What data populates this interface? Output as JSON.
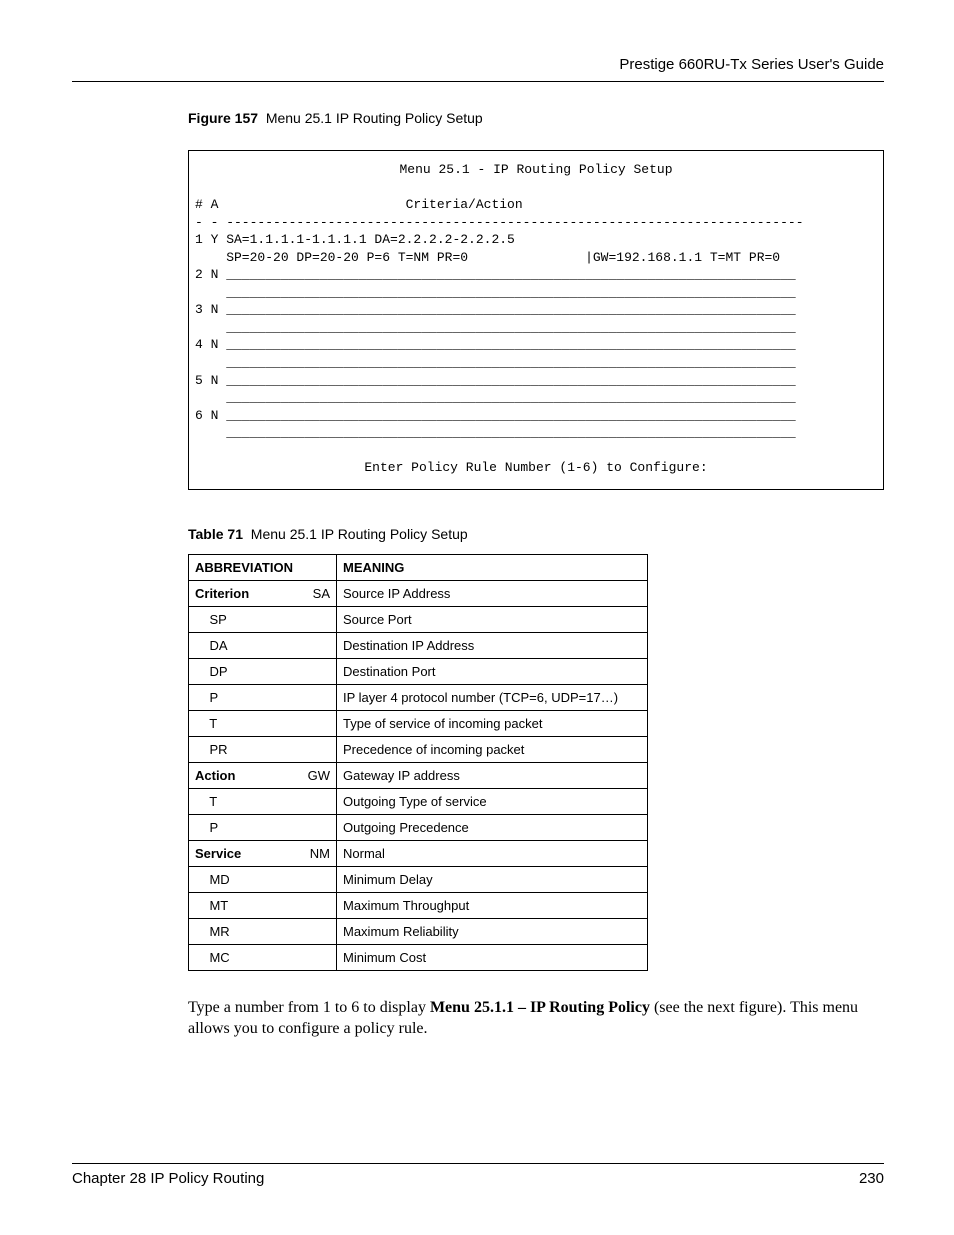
{
  "header": {
    "guide_title": "Prestige 660RU-Tx Series User's Guide"
  },
  "figure": {
    "label": "Figure 157",
    "title": "Menu 25.1 IP Routing Policy Setup",
    "menu_title": "Menu 25.1 - IP Routing Policy Setup",
    "cols_header": "# A                        Criteria/Action",
    "divider": "- - --------------------------------------------------------------------------",
    "row1a": "1 Y SA=1.1.1.1-1.1.1.1 DA=2.2.2.2-2.2.2.5",
    "row1b": "    SP=20-20 DP=20-20 P=6 T=NM PR=0               |GW=192.168.1.1 T=MT PR=0",
    "row2": "2 N _________________________________________________________________________",
    "rowpad": "    _________________________________________________________________________",
    "row3": "3 N _________________________________________________________________________",
    "row4": "4 N _________________________________________________________________________",
    "row5": "5 N _________________________________________________________________________",
    "row6": "6 N _________________________________________________________________________",
    "prompt": "Enter Policy Rule Number (1-6) to Configure:"
  },
  "table": {
    "label": "Table 71",
    "title": "Menu 25.1 IP Routing Policy Setup",
    "headers": {
      "abbr": "ABBREVIATION",
      "meaning": "MEANING"
    },
    "rows": [
      {
        "left": "Criterion",
        "right": "SA",
        "left_bold": true,
        "meaning": "Source IP Address"
      },
      {
        "left": "    SP",
        "right": "",
        "left_bold": false,
        "meaning": "Source Port"
      },
      {
        "left": "    DA",
        "right": "",
        "left_bold": false,
        "meaning": "Destination IP Address"
      },
      {
        "left": "    DP",
        "right": "",
        "left_bold": false,
        "meaning": "Destination Port"
      },
      {
        "left": "    P",
        "right": "",
        "left_bold": false,
        "meaning": "IP layer 4 protocol number (TCP=6, UDP=17…)"
      },
      {
        "left": "    T",
        "right": "",
        "left_bold": false,
        "meaning": "Type of service of incoming packet"
      },
      {
        "left": "    PR",
        "right": "",
        "left_bold": false,
        "meaning": "Precedence of incoming packet"
      },
      {
        "left": "Action",
        "right": "GW",
        "left_bold": true,
        "meaning": "Gateway IP address"
      },
      {
        "left": "    T",
        "right": "",
        "left_bold": false,
        "meaning": "Outgoing Type of service"
      },
      {
        "left": "    P",
        "right": "",
        "left_bold": false,
        "meaning": "Outgoing Precedence"
      },
      {
        "left": "Service",
        "right": "NM",
        "left_bold": true,
        "meaning": "Normal"
      },
      {
        "left": "    MD",
        "right": "",
        "left_bold": false,
        "meaning": "Minimum Delay"
      },
      {
        "left": "    MT",
        "right": "",
        "left_bold": false,
        "meaning": "Maximum Throughput"
      },
      {
        "left": "    MR",
        "right": "",
        "left_bold": false,
        "meaning": "Maximum Reliability"
      },
      {
        "left": "    MC",
        "right": "",
        "left_bold": false,
        "meaning": "Minimum Cost"
      }
    ]
  },
  "paragraph": {
    "pre": "Type a number from 1 to 6 to display ",
    "bold": "Menu 25.1.1 – IP Routing Policy",
    "post": " (see the next figure). This menu allows you to configure a policy rule."
  },
  "footer": {
    "chapter": "Chapter 28 IP Policy Routing",
    "page": "230"
  }
}
